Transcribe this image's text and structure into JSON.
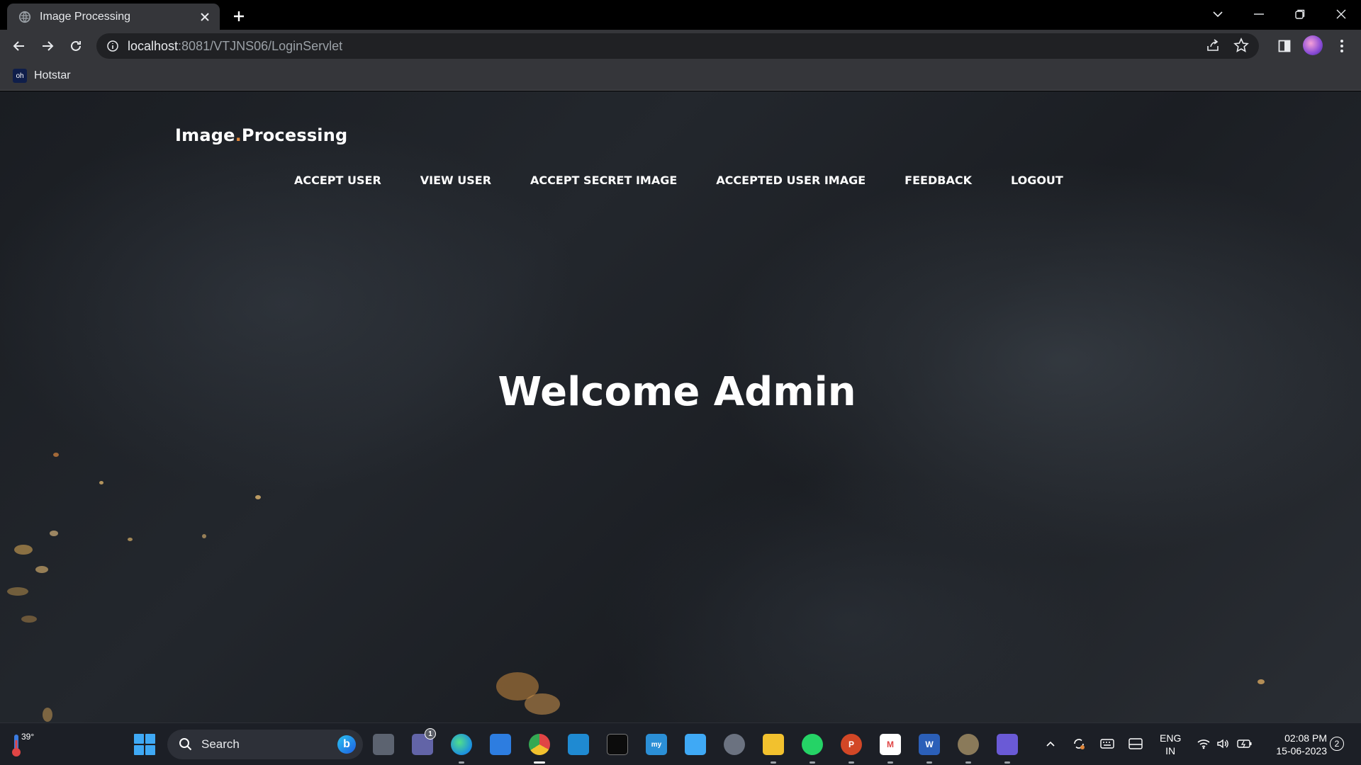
{
  "browser": {
    "tab_title": "Image Processing",
    "url_host": "localhost",
    "url_path": ":8081/VTJNS06/LoginServlet",
    "bookmark_label": "Hotstar",
    "bookmark_icon_text": "oh"
  },
  "page": {
    "brand_first": "Image",
    "brand_dot": ".",
    "brand_second": "Processing",
    "nav": [
      "ACCEPT USER",
      "VIEW USER",
      "ACCEPT SECRET IMAGE",
      "ACCEPTED USER IMAGE",
      "FEEDBACK",
      "LOGOUT"
    ],
    "welcome": "Welcome Admin"
  },
  "taskbar": {
    "temperature": "39°",
    "search_label": "Search",
    "lang_line1": "ENG",
    "lang_line2": "IN",
    "time": "02:08 PM",
    "date": "15-06-2023",
    "notification_count": "2",
    "teams_badge": "1"
  },
  "colors": {
    "brand_accent": "#e0863a",
    "chrome_bg": "#35363a",
    "omnibox_bg": "#202124",
    "taskbar_bg": "#1c1f26"
  }
}
